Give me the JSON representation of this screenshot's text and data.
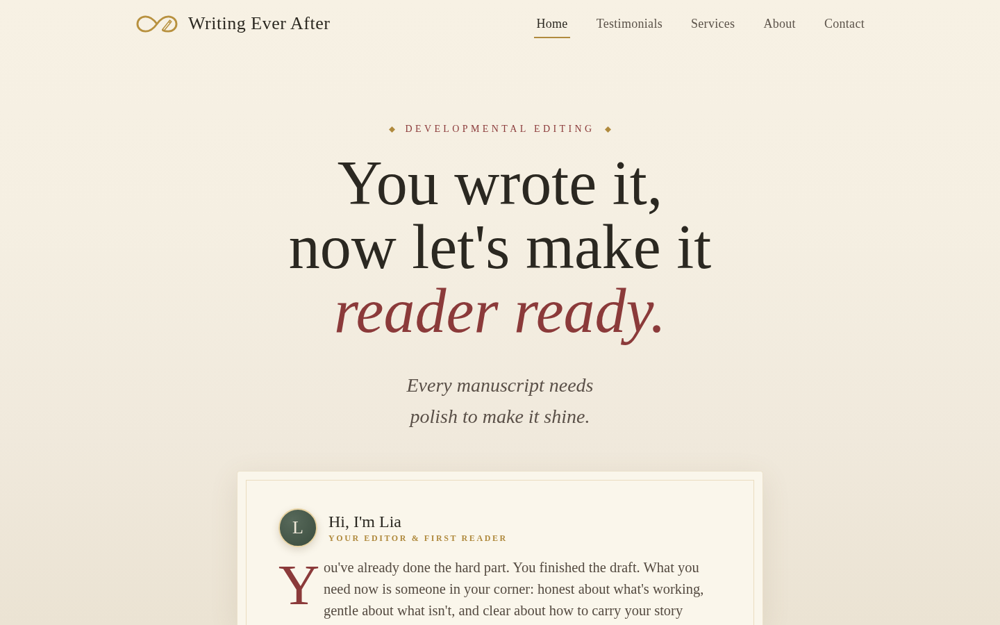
{
  "header": {
    "logo_text": "Writing Ever After",
    "nav": [
      {
        "label": "Home",
        "selected": true
      },
      {
        "label": "Testimonials",
        "selected": false
      },
      {
        "label": "Services",
        "selected": false
      },
      {
        "label": "About",
        "selected": false
      },
      {
        "label": "Contact",
        "selected": false
      }
    ]
  },
  "hero": {
    "eyebrow": "DEVELOPMENTAL EDITING",
    "headline": [
      "You wrote it,",
      "now let's make it",
      "*reader ready.*"
    ],
    "subtitle": "Every manuscript needs polish to make it shine."
  },
  "intro_card": {
    "avatar_initial": "L",
    "greeting": "Hi, I'm Lia",
    "role": "YOUR EDITOR & FIRST READER",
    "drop_cap": "Y",
    "body": "ou've already done the hard part. You finished the draft. What you need now is someone in your corner: honest about what's working, gentle about what isn't, and clear about how to carry your story"
  }
}
